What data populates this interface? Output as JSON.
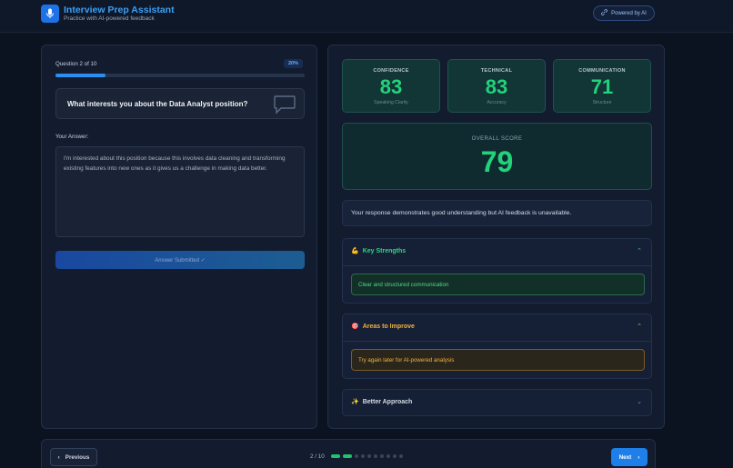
{
  "header": {
    "title": "Interview Prep Assistant",
    "subtitle": "Practice with AI-powered feedback",
    "badge": "Powered by AI"
  },
  "question_panel": {
    "counter": "Question 2 of 10",
    "progress_label": "20%",
    "progress": 0.2,
    "question": "What interests you about the Data Analyst position?",
    "answer_label": "Your Answer:",
    "answer_text": "I'm interested about this position because this involves data cleaning and transforming existing features into new ones as it gives us a challenge in making data better.",
    "submit_label": "Answer Submitted ✓"
  },
  "feedback": {
    "metrics": [
      {
        "label": "CONFIDENCE",
        "value": "83",
        "sub": "Speaking Clarity"
      },
      {
        "label": "TECHNICAL",
        "value": "83",
        "sub": "Accuracy"
      },
      {
        "label": "COMMUNICATION",
        "value": "71",
        "sub": "Structure"
      }
    ],
    "overall_label": "OVERALL SCORE",
    "overall_value": "79",
    "summary": "Your response demonstrates good understanding but AI feedback is unavailable.",
    "sections": {
      "strengths": {
        "emoji": "💪",
        "title": "Key Strengths",
        "item": "Clear and structured communication"
      },
      "improve": {
        "emoji": "🎯",
        "title": "Areas to Improve",
        "item": "Try again later for AI-powered analysis"
      },
      "better": {
        "emoji": "✨",
        "title": "Better Approach"
      }
    }
  },
  "nav": {
    "prev_label": "Previous",
    "page_indicator": "2 / 10",
    "next_label": "Next",
    "completed_dots": 2,
    "total_dots": 10
  },
  "colors": {
    "accent": "#1f7fe8",
    "score_green": "#22d37a",
    "warning": "#f2b23c"
  }
}
